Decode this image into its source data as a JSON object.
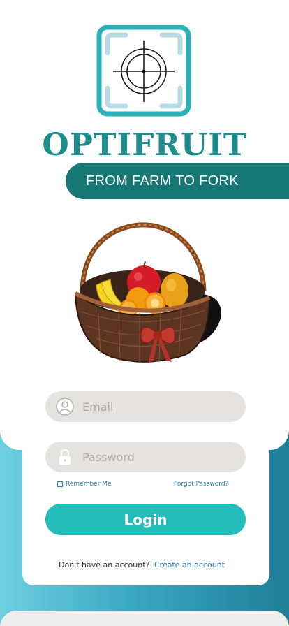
{
  "brand": {
    "title": "OPTIFRUIT",
    "tagline": "FROM FARM TO FORK",
    "logo_icon": "crosshair-scan-icon",
    "colors": {
      "teal_dark": "#177775",
      "teal_title": "#1c8d8c",
      "accent": "#25bcbc"
    }
  },
  "hero": {
    "image_icon": "fruit-basket-icon"
  },
  "form": {
    "email": {
      "placeholder": "Email",
      "value": "",
      "icon": "user-icon"
    },
    "password": {
      "placeholder": "Password",
      "value": "",
      "icon": "lock-icon"
    },
    "remember_label": "Remember Me",
    "remember_checked": false,
    "forgot_label": "Forgot Password?",
    "login_label": "Login",
    "signup_prompt": "Don't have an account?",
    "signup_link": "Create an account"
  }
}
